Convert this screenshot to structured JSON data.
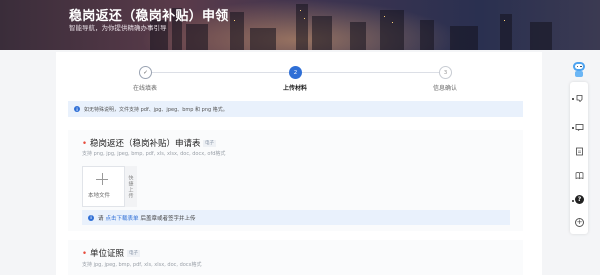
{
  "banner": {
    "title": "稳岗返还（稳岗补贴）申领",
    "subtitle": "智能导航，为你提供精确办事引导"
  },
  "steps": [
    {
      "number": "✓",
      "label": "在线填表",
      "state": "done"
    },
    {
      "number": "2",
      "label": "上传材料",
      "state": "active"
    },
    {
      "number": "3",
      "label": "信息确认",
      "state": "todo"
    }
  ],
  "notice": {
    "icon": "info-icon",
    "text": "如无特殊说明，文件支持 pdf、jpg、jpeg、bmp 和 png 格式。"
  },
  "sections": [
    {
      "required_mark": "•",
      "title": "稳岗返还（稳岗补贴）申请表",
      "tag": "电子",
      "hint": "支持 png, jpg, jpeg, bmp, pdf, xls, xlsx, doc, docx, ofd格式",
      "upload_label": "本地文件",
      "quick_upload_label": "快捷上传",
      "note_prefix": "请",
      "note_link": "点击下载表单",
      "note_suffix": "后盖章或者签字并上传"
    },
    {
      "required_mark": "•",
      "title": "单位证照",
      "tag": "电子",
      "hint": "支持 jpg, jpeg, bmp, pdf, xls, xlsx, doc, docx格式"
    }
  ],
  "toolbar": {
    "items": [
      "robot-assistant-icon",
      "feedback-icon",
      "message-icon",
      "document-icon",
      "guide-book-icon",
      "help-icon",
      "add-icon"
    ],
    "help_glyph": "?",
    "add_glyph": "+"
  },
  "colors": {
    "accent": "#2f6fd6",
    "required": "#e74c3c",
    "notice_bg": "#e9f1fc"
  }
}
